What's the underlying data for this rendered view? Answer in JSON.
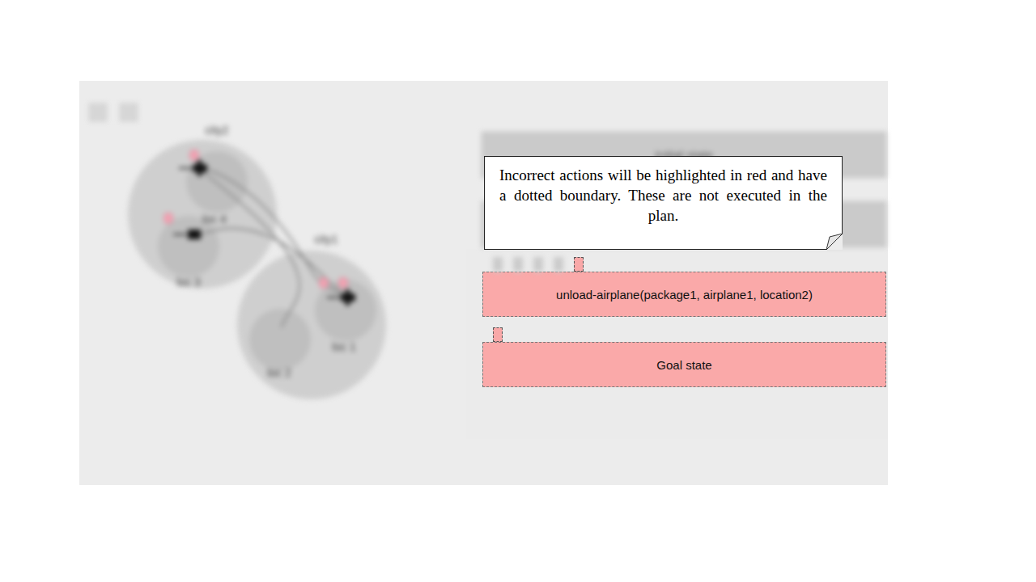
{
  "toolbar": {
    "buttons": 2
  },
  "map": {
    "cities": [
      {
        "name": "city2",
        "locations": [
          {
            "name": "loc 4"
          },
          {
            "name": "loc 3"
          }
        ]
      },
      {
        "name": "city1",
        "locations": [
          {
            "name": "loc 1"
          },
          {
            "name": "loc 2"
          }
        ]
      }
    ],
    "vehicles": [
      {
        "kind": "airplane",
        "packages": 1
      },
      {
        "kind": "truck",
        "packages": 1
      },
      {
        "kind": "airplane",
        "packages": 2
      }
    ]
  },
  "plan": {
    "steps": [
      {
        "label": "Initial state",
        "incorrect": false
      },
      {
        "incorrect": false
      }
    ],
    "markers": [
      {
        "incorrect": false
      },
      {
        "incorrect": false
      },
      {
        "incorrect": false
      },
      {
        "incorrect": false
      },
      {
        "incorrect": true
      }
    ],
    "action": {
      "label": "unload-airplane(package1, airplane1, location2)",
      "incorrect": true
    },
    "goal_marker": {
      "incorrect": true
    },
    "goal": {
      "label": "Goal state",
      "incorrect": true
    }
  },
  "tooltip": {
    "text": "Incorrect actions will be highlighted in red and have a dotted boundary. These are not executed in the plan."
  }
}
